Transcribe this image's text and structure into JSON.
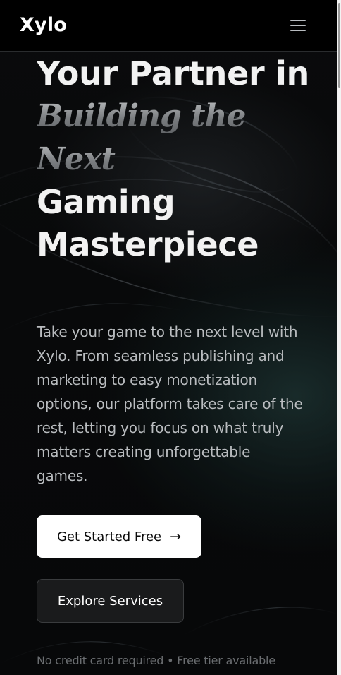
{
  "header": {
    "logo": "Xylo",
    "menu_icon": "hamburger-menu-icon"
  },
  "hero": {
    "heading_line_1": "Your Partner in",
    "heading_script_1": "Building the",
    "heading_script_2": "Next",
    "heading_line_3": "Gaming",
    "heading_line_4": "Masterpiece",
    "description": "Take your game to the next level with Xylo. From seamless publishing and marketing to easy monetization options, our platform takes care of the rest, letting you focus on what truly matters creating unforgettable games."
  },
  "cta": {
    "primary_label": "Get Started Free",
    "primary_arrow": "→",
    "secondary_label": "Explore Services"
  },
  "footnote": "No credit card required • Free tier available",
  "colors": {
    "background": "#08090a",
    "primary_button": "#ffffff",
    "secondary_button": "#1a1b1c",
    "accent_glow": "#264644"
  }
}
